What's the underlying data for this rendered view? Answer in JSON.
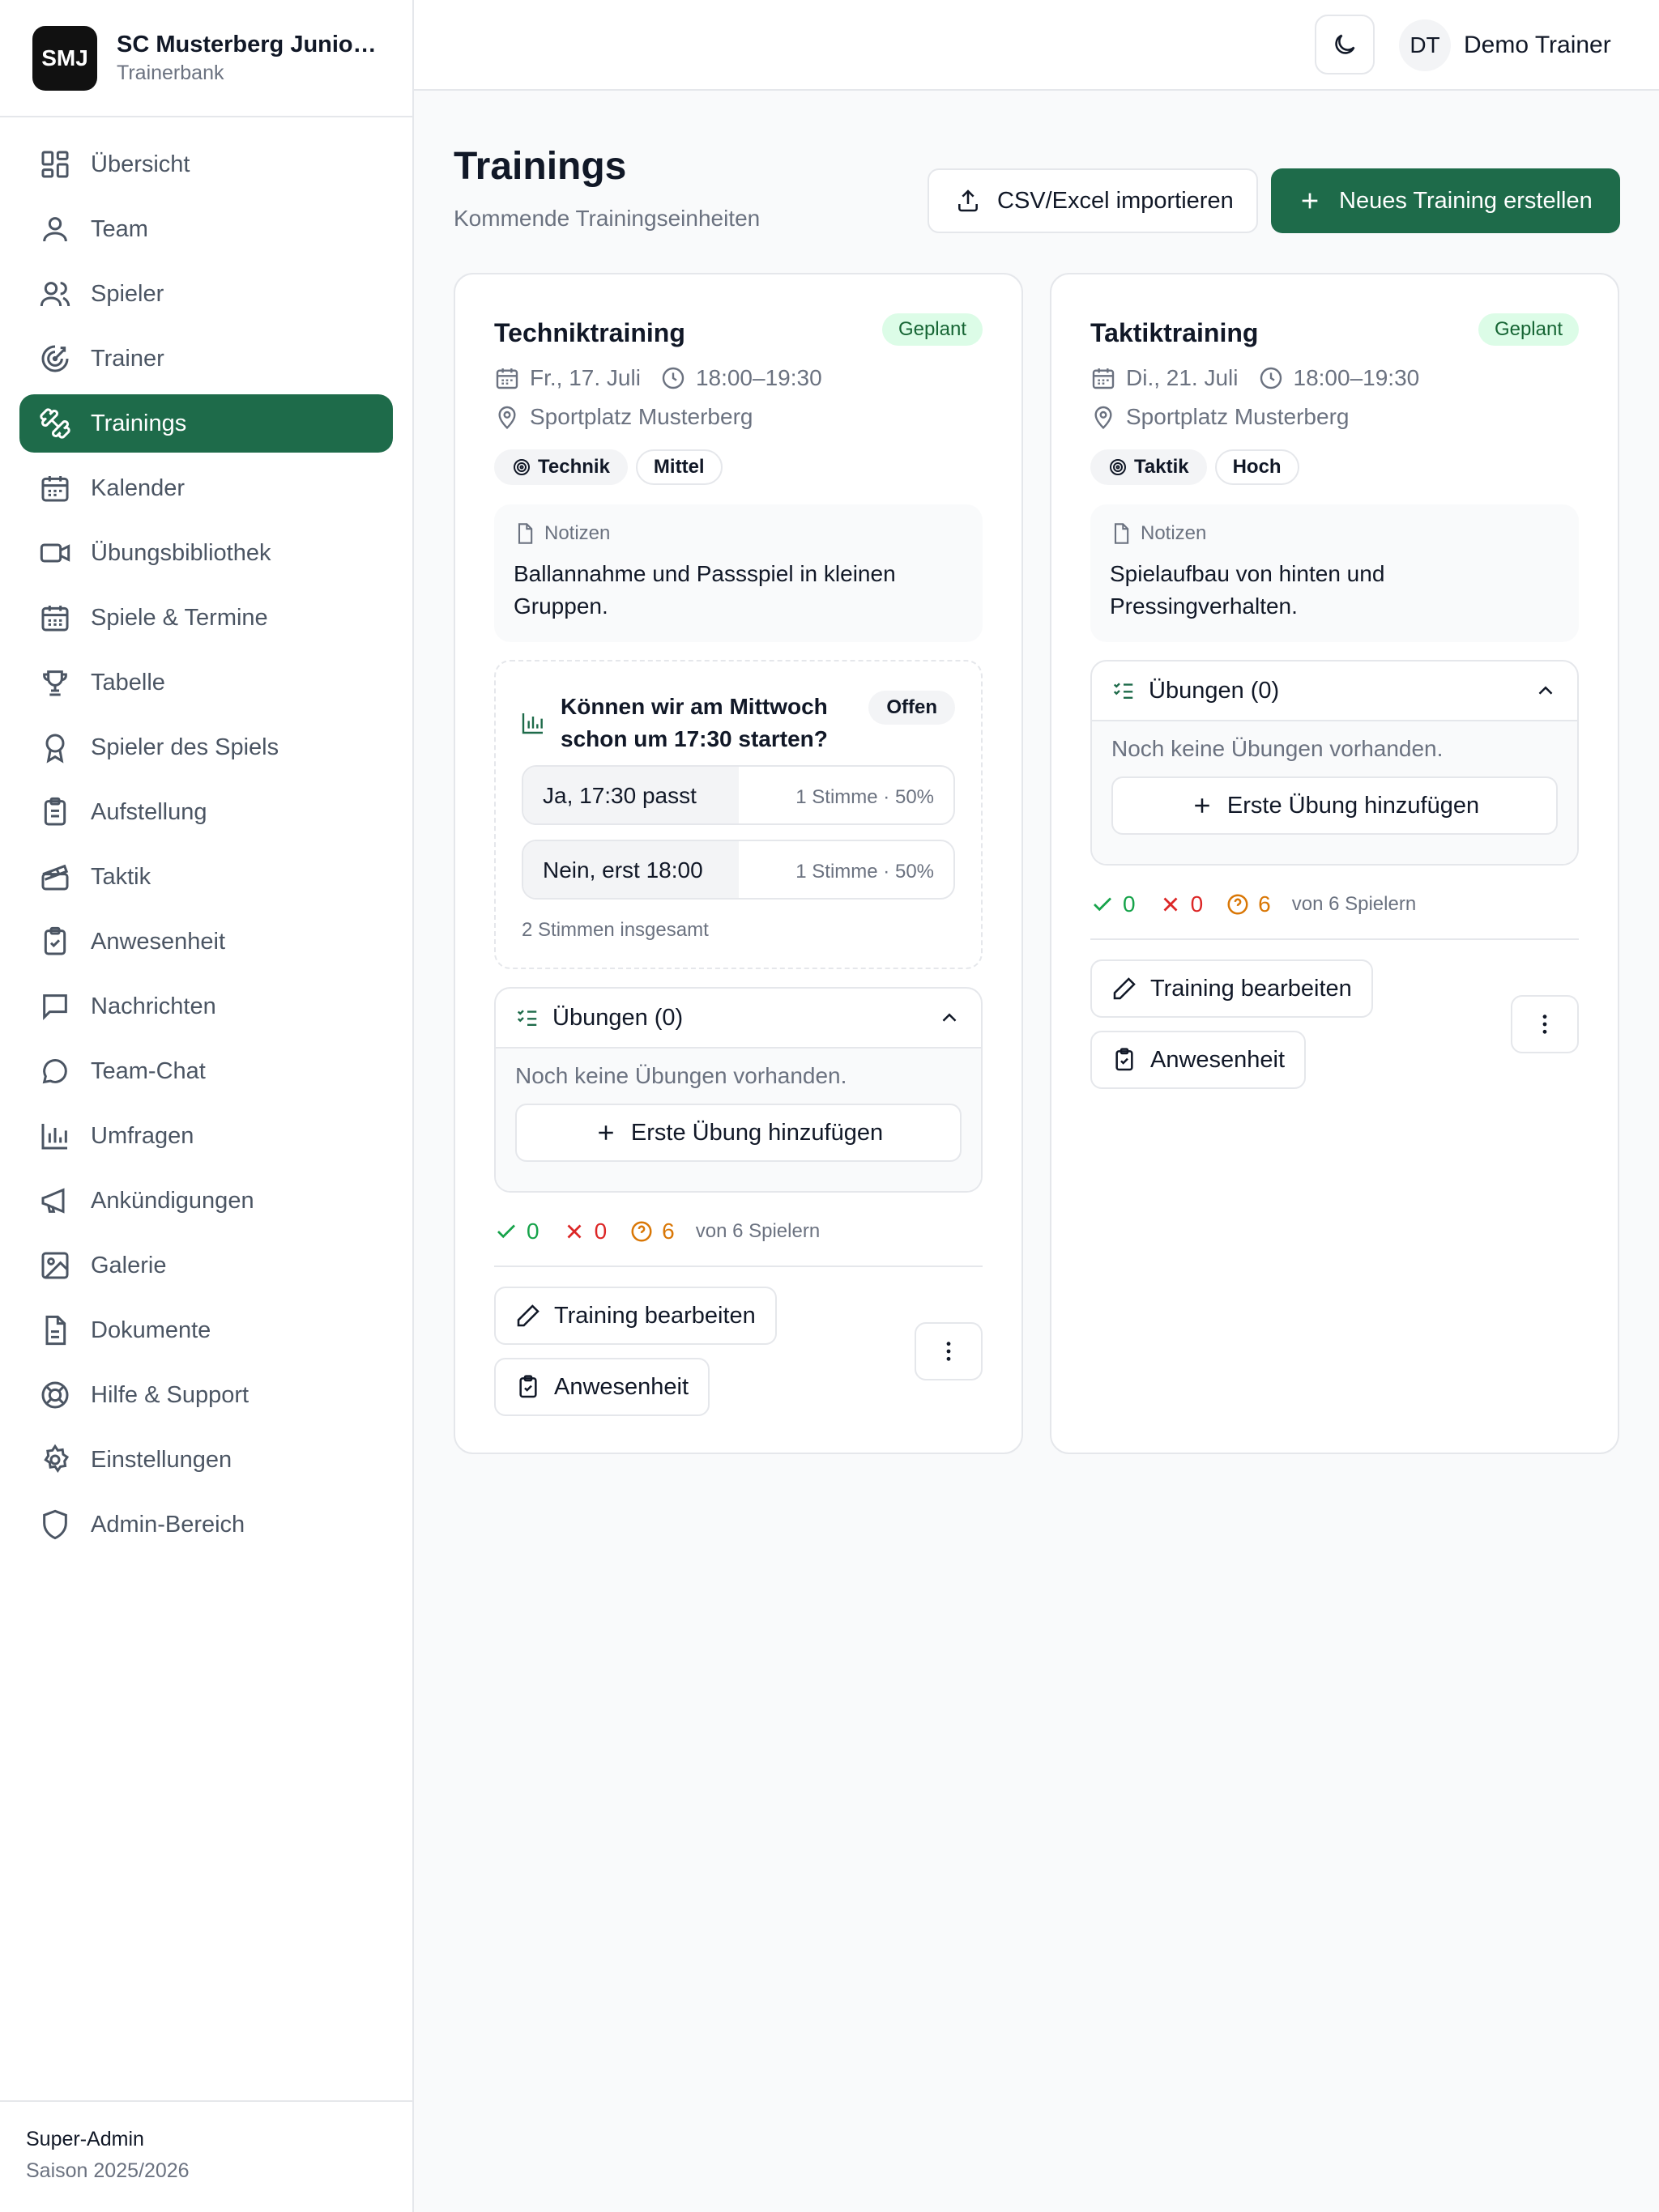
{
  "brand": {
    "logo": "SMJ",
    "name": "SC Musterberg Junio…",
    "subtitle": "Trainerbank"
  },
  "sidebar": {
    "items": [
      {
        "label": "Übersicht",
        "icon": "dashboard-icon"
      },
      {
        "label": "Team",
        "icon": "user-icon"
      },
      {
        "label": "Spieler",
        "icon": "users-icon"
      },
      {
        "label": "Trainer",
        "icon": "target-icon"
      },
      {
        "label": "Trainings",
        "icon": "dumbbell-icon",
        "active": true
      },
      {
        "label": "Kalender",
        "icon": "calendar-icon"
      },
      {
        "label": "Übungsbibliothek",
        "icon": "video-icon"
      },
      {
        "label": "Spiele & Termine",
        "icon": "calendar-days-icon"
      },
      {
        "label": "Tabelle",
        "icon": "trophy-icon"
      },
      {
        "label": "Spieler des Spiels",
        "icon": "award-icon"
      },
      {
        "label": "Aufstellung",
        "icon": "clipboard-list-icon"
      },
      {
        "label": "Taktik",
        "icon": "clapperboard-icon"
      },
      {
        "label": "Anwesenheit",
        "icon": "clipboard-check-icon"
      },
      {
        "label": "Nachrichten",
        "icon": "message-square-icon"
      },
      {
        "label": "Team-Chat",
        "icon": "message-circle-icon"
      },
      {
        "label": "Umfragen",
        "icon": "bar-chart-icon"
      },
      {
        "label": "Ankündigungen",
        "icon": "megaphone-icon"
      },
      {
        "label": "Galerie",
        "icon": "gallery-icon"
      },
      {
        "label": "Dokumente",
        "icon": "file-text-icon"
      },
      {
        "label": "Hilfe & Support",
        "icon": "life-buoy-icon"
      },
      {
        "label": "Einstellungen",
        "icon": "settings-icon"
      },
      {
        "label": "Admin-Bereich",
        "icon": "shield-icon"
      }
    ],
    "footer": {
      "role": "Super-Admin",
      "season": "Saison 2025/2026"
    }
  },
  "header": {
    "theme_icon": "moon-icon",
    "user_initials": "DT",
    "user_name": "Demo Trainer"
  },
  "page": {
    "title": "Trainings",
    "subtitle": "Kommende Trainingseinheiten",
    "import_label": "CSV/Excel importieren",
    "new_label": "Neues Training erstellen"
  },
  "trainings": [
    {
      "title": "Techniktraining",
      "status": "Geplant",
      "date": "Fr., 17. Juli",
      "time": "18:00–19:30",
      "location": "Sportplatz Musterberg",
      "focus": "Technik",
      "intensity": "Mittel",
      "notes_label": "Notizen",
      "notes": "Ballannahme und Passspiel in kleinen Gruppen.",
      "poll": {
        "question": "Können wir am Mittwoch schon um 17:30 starten?",
        "status": "Offen",
        "options": [
          {
            "label": "Ja, 17:30 passt",
            "votes": "1 Stimme · 50%",
            "share": 0.5
          },
          {
            "label": "Nein, erst 18:00",
            "votes": "1 Stimme · 50%",
            "share": 0.5
          }
        ],
        "total": "2 Stimmen insgesamt"
      },
      "exercises": {
        "title": "Übungen (0)",
        "empty": "Noch keine Übungen vorhanden.",
        "add_label": "Erste Übung hinzufügen"
      },
      "attendance": {
        "present": "0",
        "absent": "0",
        "unknown": "6",
        "total": "von 6 Spielern"
      },
      "edit_label": "Training bearbeiten",
      "attendance_label": "Anwesenheit"
    },
    {
      "title": "Taktiktraining",
      "status": "Geplant",
      "date": "Di., 21. Juli",
      "time": "18:00–19:30",
      "location": "Sportplatz Musterberg",
      "focus": "Taktik",
      "intensity": "Hoch",
      "notes_label": "Notizen",
      "notes": "Spielaufbau von hinten und Pressingverhalten.",
      "exercises": {
        "title": "Übungen (0)",
        "empty": "Noch keine Übungen vorhanden.",
        "add_label": "Erste Übung hinzufügen"
      },
      "attendance": {
        "present": "0",
        "absent": "0",
        "unknown": "6",
        "total": "von 6 Spielern"
      },
      "edit_label": "Training bearbeiten",
      "attendance_label": "Anwesenheit"
    }
  ],
  "colors": {
    "accent": "#1e6b4a",
    "badge_bg": "#dcfce7",
    "present": "#16a34a",
    "absent": "#dc2626",
    "unknown": "#d97706"
  }
}
